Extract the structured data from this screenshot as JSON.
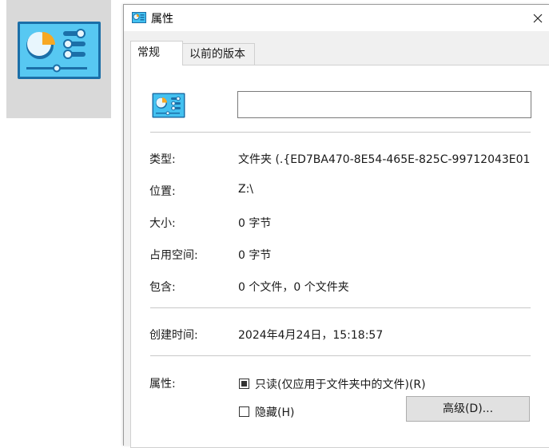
{
  "window": {
    "title": "属性",
    "close_glyph": "✕"
  },
  "tabs": [
    {
      "label": "常规",
      "active": true
    },
    {
      "label": "以前的版本",
      "active": false
    }
  ],
  "general": {
    "name_value": "",
    "rows": [
      {
        "label": "类型:",
        "value": "文件夹 (.{ED7BA470-8E54-465E-825C-99712043E01"
      },
      {
        "label": "位置:",
        "value": "Z:\\"
      },
      {
        "label": "大小:",
        "value": "0 字节"
      },
      {
        "label": "占用空间:",
        "value": "0 字节"
      },
      {
        "label": "包含:",
        "value": "0 个文件，0 个文件夹"
      }
    ],
    "created_label": "创建时间:",
    "created_value": "2024年4月24日，15:18:57",
    "attributes_label": "属性:",
    "readonly_label": "只读(仅应用于文件夹中的文件)(R)",
    "readonly_state": "indeterminate",
    "hidden_label": "隐藏(H)",
    "hidden_checked": false,
    "advanced_button": "高级(D)..."
  },
  "icons": {
    "app_icon": "control-panel-icon",
    "title_icon": "control-panel-icon",
    "close": "close-icon"
  },
  "colors": {
    "icon_blue": "#29a8e0",
    "icon_dark": "#1b6fa8",
    "icon_orange": "#f7a823",
    "dialog_bg": "#f0f0f0",
    "panel_bg": "#ffffff"
  }
}
